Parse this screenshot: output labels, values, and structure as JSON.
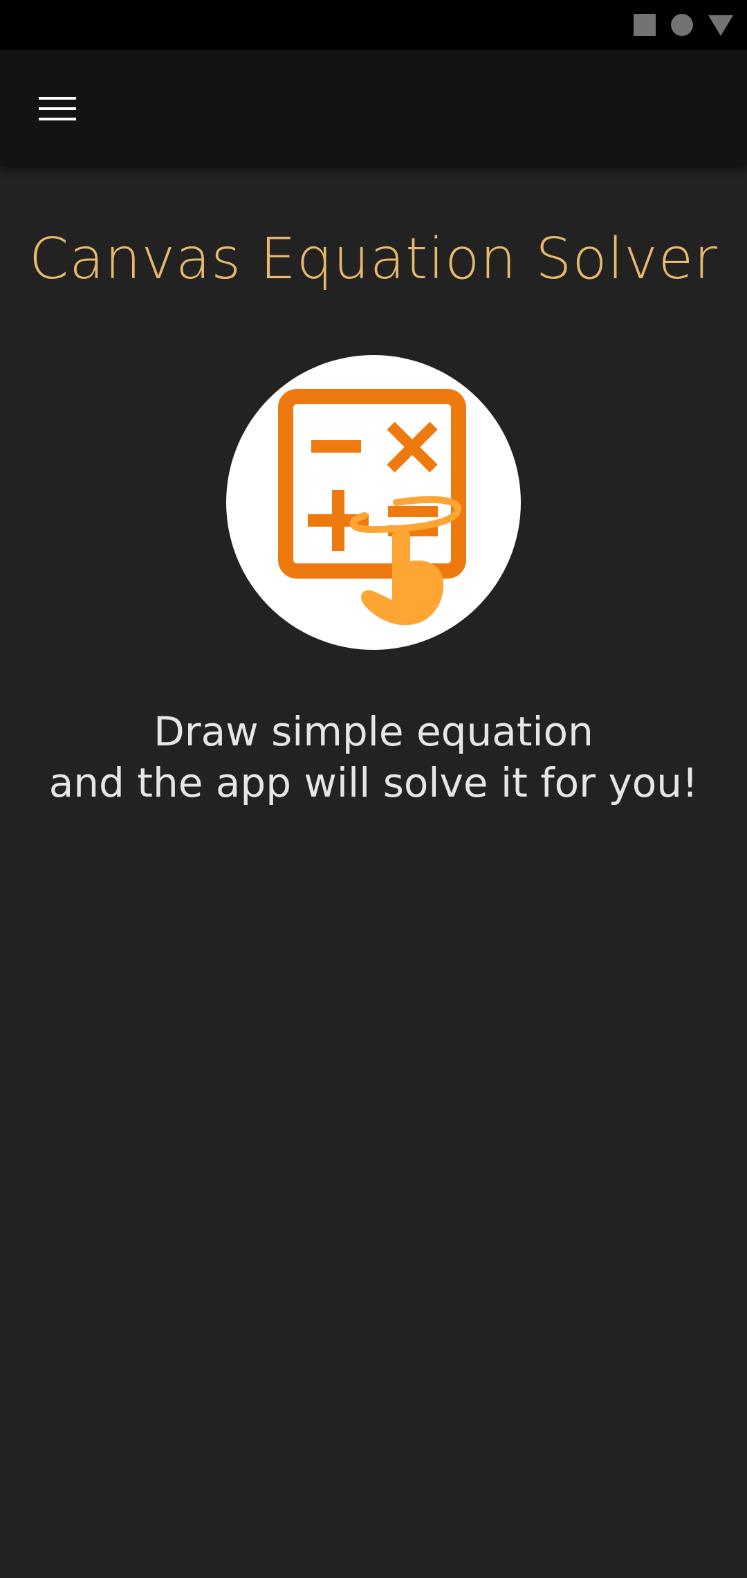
{
  "status_bar": {
    "icons": [
      "square-icon",
      "circle-icon",
      "triangle-icon"
    ],
    "icon_color": "#737373"
  },
  "app_bar": {
    "menu_icon": "hamburger-menu-icon"
  },
  "main": {
    "title": "Canvas Equation Solver",
    "title_color": "#E8B86C",
    "logo": {
      "icon": "calculator-hand-drawing-icon",
      "primary_color": "#EE7A0F",
      "secondary_color": "#FFA533"
    },
    "tagline_line1": "Draw simple equation",
    "tagline_line2": "and the app will solve it for you!"
  }
}
